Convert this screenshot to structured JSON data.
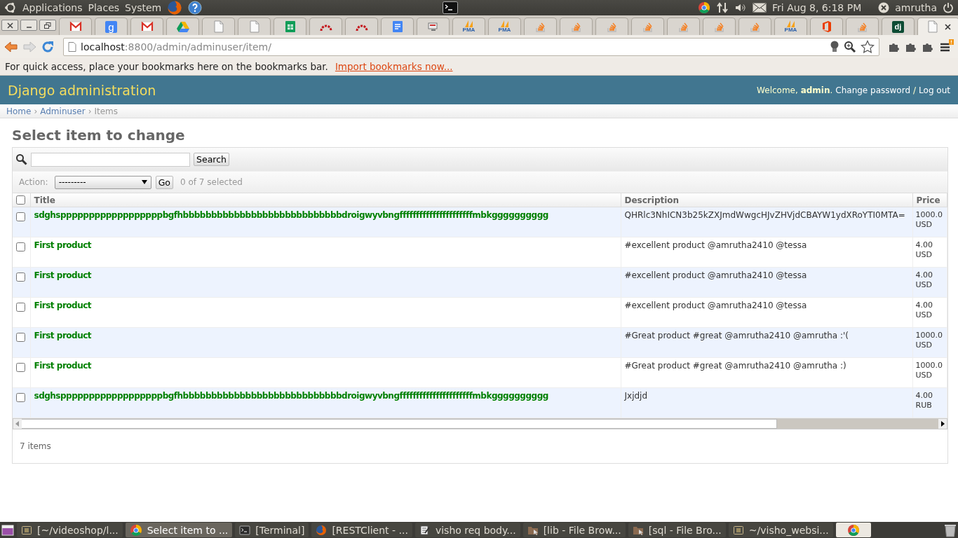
{
  "top_panel": {
    "menus": [
      "Applications",
      "Places",
      "System"
    ],
    "clock": "Fri Aug  8,  6:18 PM",
    "user": "amrutha"
  },
  "browser": {
    "tabs": [
      {
        "kind": "gmail",
        "selected": false
      },
      {
        "kind": "google",
        "glyph": "g",
        "selected": false
      },
      {
        "kind": "gmail",
        "selected": false
      },
      {
        "kind": "drive",
        "selected": false
      },
      {
        "kind": "page",
        "selected": false
      },
      {
        "kind": "page",
        "selected": false
      },
      {
        "kind": "sheets",
        "selected": false
      },
      {
        "kind": "arc",
        "selected": false
      },
      {
        "kind": "arc",
        "selected": false
      },
      {
        "kind": "docs",
        "selected": false
      },
      {
        "kind": "screen",
        "selected": false
      },
      {
        "kind": "pma",
        "glyph": "PMA",
        "selected": false
      },
      {
        "kind": "pma",
        "glyph": "PMA",
        "selected": false
      },
      {
        "kind": "stack",
        "selected": false
      },
      {
        "kind": "stack",
        "selected": false
      },
      {
        "kind": "stack",
        "selected": false
      },
      {
        "kind": "stack",
        "selected": false
      },
      {
        "kind": "stack",
        "selected": false
      },
      {
        "kind": "stack",
        "selected": false
      },
      {
        "kind": "stack",
        "selected": false
      },
      {
        "kind": "pma",
        "glyph": "PMA",
        "selected": false
      },
      {
        "kind": "office",
        "selected": false
      },
      {
        "kind": "stack",
        "selected": false
      },
      {
        "kind": "django",
        "glyph": "dj",
        "selected": false
      },
      {
        "kind": "page",
        "selected": true
      }
    ],
    "url": {
      "host": "localhost",
      "path": ":8800/admin/adminuser/item/"
    },
    "bookmarks_bar": {
      "text": "For quick access, place your bookmarks here on the bookmarks bar.",
      "link": "Import bookmarks now..."
    }
  },
  "header": {
    "title": "Django administration",
    "welcome": "Welcome, **admin**.",
    "links": [
      "Change password",
      "Log out"
    ],
    "separator": "/"
  },
  "breadcrumbs": [
    {
      "kind": "link",
      "text": "Home"
    },
    {
      "kind": "sep",
      "text": "›"
    },
    {
      "kind": "link",
      "text": "Adminuser"
    },
    {
      "kind": "sep",
      "text": "›"
    },
    {
      "kind": "current",
      "text": "Items"
    }
  ],
  "heading": "Select item to change",
  "search": {
    "button": "Search"
  },
  "actions": {
    "label": "Action:",
    "value": "---------",
    "go": "Go",
    "counter": "0 of 7 selected"
  },
  "table": {
    "select_all_checked": false,
    "columns": [
      "Title",
      "Description",
      "Price"
    ],
    "rows": [
      {
        "checked": false,
        "title": "sdghsppppppppppppppppppbgfhbbbbbbbbbbbbbbbbbbbbbbbbbbbbdroigwyvbngffffffffffffffffffffffmbkgggggggggg",
        "description": "QHRlc3NhICN3b25kZXJmdWwgcHJvZHVjdCBAYW1ydXRoYTI0MTA=",
        "price": "1000.0",
        "currency": "USD"
      },
      {
        "checked": false,
        "title": "First product",
        "description": "#excellent product @amrutha2410 @tessa",
        "price": "4.00",
        "currency": "USD"
      },
      {
        "checked": false,
        "title": "First product",
        "description": "#excellent product @amrutha2410 @tessa",
        "price": "4.00",
        "currency": "USD"
      },
      {
        "checked": false,
        "title": "First product",
        "description": "#excellent product @amrutha2410 @tessa",
        "price": "4.00",
        "currency": "USD"
      },
      {
        "checked": false,
        "title": "First product",
        "description": "#Great product #great @amrutha2410 @amrutha :'(",
        "price": "1000.0",
        "currency": "USD"
      },
      {
        "checked": false,
        "title": "First product",
        "description": "#Great product #great @amrutha2410 @amrutha :)",
        "price": "1000.0",
        "currency": "USD"
      },
      {
        "checked": false,
        "title": "sdghsppppppppppppppppppbgfhbbbbbbbbbbbbbbbbbbbbbbbbbbbbdroigwyvbngffffffffffffffffffffffmbkgggggggggg",
        "description": "Jxjdjd",
        "price": "4.00",
        "currency": "RUB"
      }
    ]
  },
  "paginator": "7 items",
  "taskbar": [
    {
      "kind": "editor",
      "label": "[~/videoshop/l...",
      "selected": false
    },
    {
      "kind": "chrome",
      "label": "Select item to ...",
      "selected": true
    },
    {
      "kind": "terminal",
      "label": "[Terminal]",
      "selected": false
    },
    {
      "kind": "firefox",
      "label": "[RESTClient - ...",
      "selected": false
    },
    {
      "kind": "notepad",
      "label": "visho req body...",
      "selected": false
    },
    {
      "kind": "folder",
      "label": "[lib - File Brow...",
      "selected": false
    },
    {
      "kind": "folder",
      "label": "[sql - File Bro...",
      "selected": false
    },
    {
      "kind": "editor",
      "label": "~/visho_websi...",
      "selected": false
    },
    {
      "kind": "chrome",
      "selected": true
    }
  ]
}
